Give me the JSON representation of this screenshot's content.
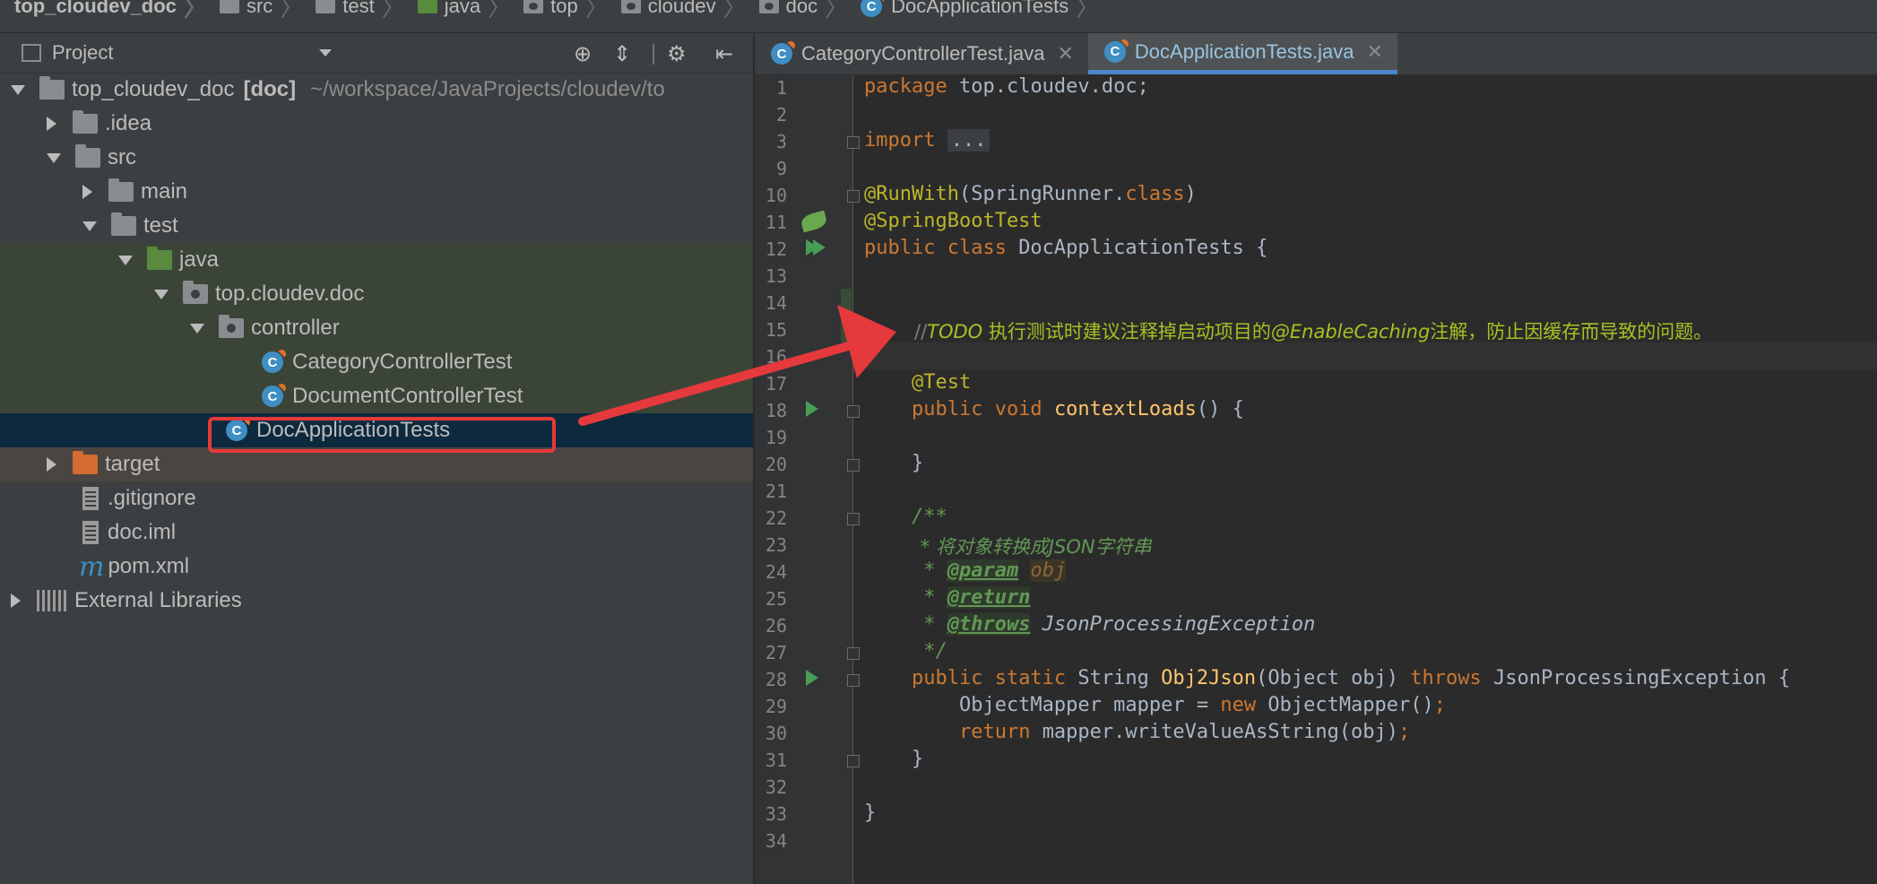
{
  "breadcrumb": [
    "top_cloudev_doc",
    "src",
    "test",
    "java",
    "top",
    "cloudev",
    "doc",
    "DocApplicationTests"
  ],
  "project_panel": {
    "title": "Project",
    "root": {
      "label": "top_cloudev_doc",
      "module": "[doc]",
      "path": "~/workspace/JavaProjects/cloudev/to"
    },
    "items": [
      ".idea",
      "src",
      "main",
      "test",
      "java",
      "top.cloudev.doc",
      "controller",
      "CategoryControllerTest",
      "DocumentControllerTest",
      "DocApplicationTests",
      "target",
      ".gitignore",
      "doc.iml",
      "pom.xml",
      "External Libraries"
    ]
  },
  "tabs": [
    {
      "label": "CategoryControllerTest.java",
      "active": false
    },
    {
      "label": "DocApplicationTests.java",
      "active": true
    }
  ],
  "editor": {
    "line_numbers": [
      "1",
      "2",
      "3",
      "9",
      "10",
      "11",
      "12",
      "13",
      "14",
      "15",
      "16",
      "17",
      "18",
      "19",
      "20",
      "21",
      "22",
      "23",
      "24",
      "25",
      "26",
      "27",
      "28",
      "29",
      "30",
      "31",
      "32",
      "33",
      "34"
    ],
    "package_name": "top.cloudev.doc;",
    "import_folded": "...",
    "todo_comment": "//TODO 执行测试时建议注释掉启动项目的@EnableCaching注解，防止因缓存而导致的问题。",
    "javadoc_desc": " * 将对象转换成JSON字符串",
    "method_name": "contextLoads",
    "static_method": "Obj2Json",
    "class_name": "DocApplicationTests"
  },
  "colors": {
    "keyword": "#cc7832",
    "annotation": "#bbb529",
    "todo": "#a8c023",
    "arrow": "#e5393b"
  }
}
